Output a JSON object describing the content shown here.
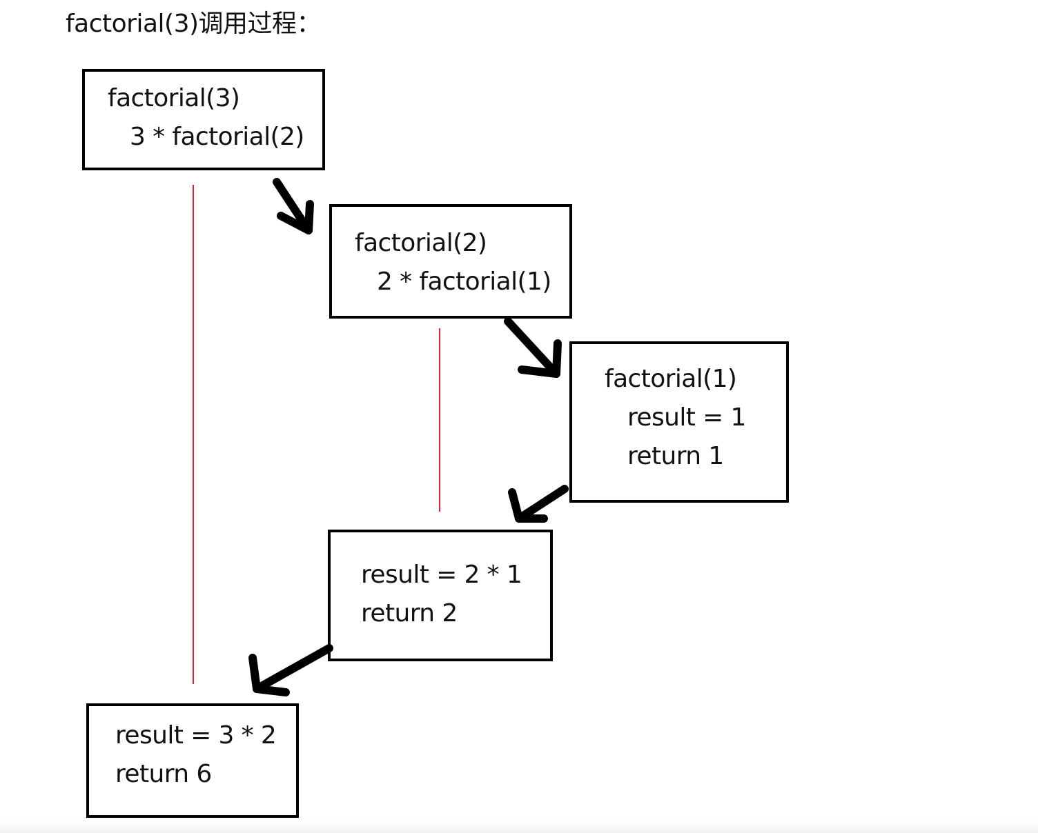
{
  "title": "factorial(3)调用过程：",
  "frames": [
    {
      "id": "call-3",
      "lines": [
        "factorial(3)",
        "3 * factorial(2)"
      ]
    },
    {
      "id": "call-2",
      "lines": [
        "factorial(2)",
        "2 * factorial(1)"
      ]
    },
    {
      "id": "call-1",
      "lines": [
        "factorial(1)",
        "result = 1",
        "return 1"
      ]
    },
    {
      "id": "return-2",
      "lines": [
        "result = 2 * 1",
        "return 2"
      ]
    },
    {
      "id": "return-6",
      "lines": [
        "result = 3 * 2",
        "return 6"
      ]
    }
  ],
  "colors": {
    "frame_border": "#000000",
    "arrow": "#000000",
    "stack_guide": "#e0202a",
    "text": "#111111"
  }
}
